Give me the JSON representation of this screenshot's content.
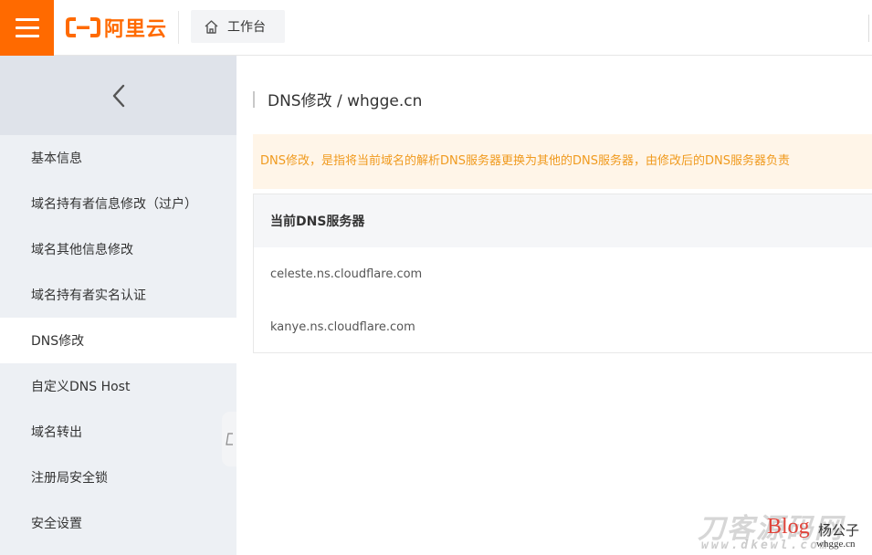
{
  "topbar": {
    "brand": "阿里云",
    "workbench_label": "工作台"
  },
  "sidebar": {
    "items": [
      {
        "label": "基本信息"
      },
      {
        "label": "域名持有者信息修改（过户）"
      },
      {
        "label": "域名其他信息修改"
      },
      {
        "label": "域名持有者实名认证"
      },
      {
        "label": "DNS修改",
        "active": true
      },
      {
        "label": "自定义DNS Host"
      },
      {
        "label": "域名转出"
      },
      {
        "label": "注册局安全锁"
      },
      {
        "label": "安全设置"
      }
    ]
  },
  "main": {
    "title": "DNS修改 / whgge.cn",
    "notice": "DNS修改，是指将当前域名的解析DNS服务器更换为其他的DNS服务器，由修改后的DNS服务器负责",
    "table": {
      "header": "当前DNS服务器",
      "rows": [
        "celeste.ns.cloudflare.com",
        "kanye.ns.cloudflare.com"
      ]
    }
  },
  "watermark": {
    "big": "刀客源码网",
    "small": "www.dkewl.com",
    "blog": "Blog",
    "author": "杨公子",
    "site": "whgge.cn"
  },
  "colors": {
    "brand": "#ff6a00",
    "notice_bg": "#fff5e8",
    "notice_text": "#f09a1e"
  }
}
